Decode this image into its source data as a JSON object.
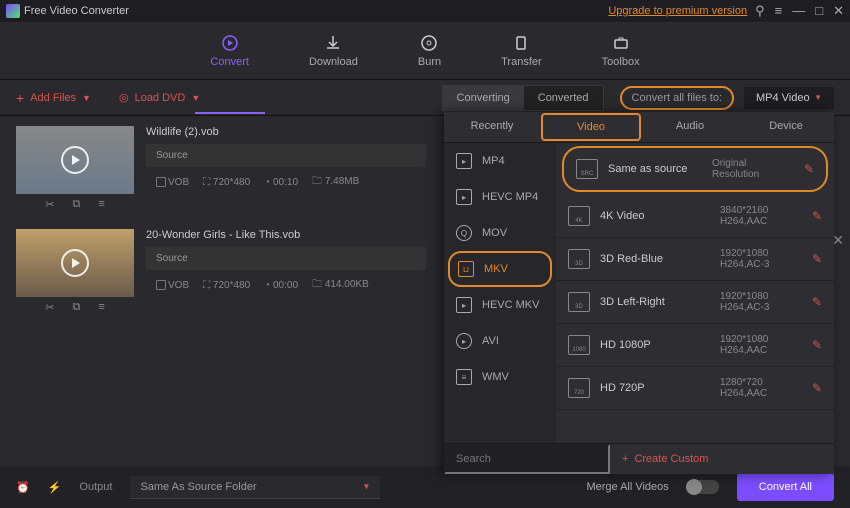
{
  "title_bar": {
    "app_name": "Free Video Converter",
    "upgrade_link": "Upgrade to premium version"
  },
  "main_nav": {
    "convert": "Convert",
    "download": "Download",
    "burn": "Burn",
    "transfer": "Transfer",
    "toolbox": "Toolbox"
  },
  "toolbar": {
    "add_files": "Add Files",
    "load_dvd": "Load DVD",
    "tab_converting": "Converting",
    "tab_converted": "Converted",
    "convert_target_label": "Convert all files to:",
    "convert_target_value": "MP4 Video"
  },
  "files": [
    {
      "name": "Wildlife  (2).vob",
      "source_label": "Source",
      "codec": "VOB",
      "dimensions": "720*480",
      "duration": "00:10",
      "filesize": "7.48MB"
    },
    {
      "name": "20-Wonder Girls - Like This.vob",
      "source_label": "Source",
      "codec": "VOB",
      "dimensions": "720*480",
      "duration": "00:00",
      "filesize": "414.00KB"
    }
  ],
  "panel": {
    "tabs": {
      "recently": "Recently",
      "video": "Video",
      "audio": "Audio",
      "device": "Device"
    },
    "formats": [
      "MP4",
      "HEVC MP4",
      "MOV",
      "MKV",
      "HEVC MKV",
      "AVI",
      "WMV"
    ],
    "resolutions": [
      {
        "name": "Same as source",
        "meta1": "Original Resolution",
        "meta2": ""
      },
      {
        "name": "4K Video",
        "meta1": "3840*2160",
        "meta2": "H264,AAC"
      },
      {
        "name": "3D Red-Blue",
        "meta1": "1920*1080",
        "meta2": "H264,AC-3"
      },
      {
        "name": "3D Left-Right",
        "meta1": "1920*1080",
        "meta2": "H264,AC-3"
      },
      {
        "name": "HD 1080P",
        "meta1": "1920*1080",
        "meta2": "H264,AAC"
      },
      {
        "name": "HD 720P",
        "meta1": "1280*720",
        "meta2": "H264,AAC"
      }
    ],
    "search_placeholder": "Search",
    "create_custom": "Create Custom"
  },
  "bottom": {
    "output_label": "Output",
    "output_value": "Same As Source Folder",
    "merge_label": "Merge All Videos",
    "convert_all": "Convert All"
  }
}
